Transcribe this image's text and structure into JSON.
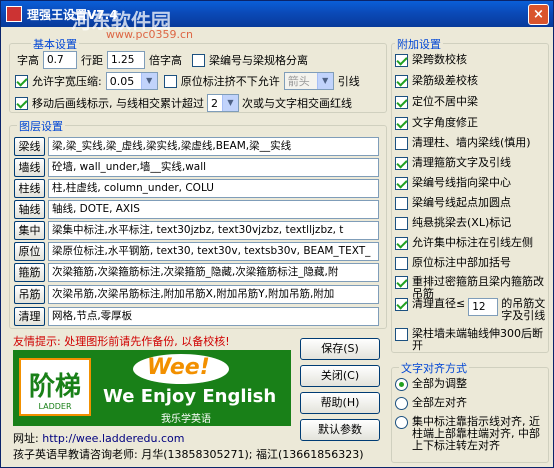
{
  "window": {
    "title": "理强王设置V7.4",
    "watermark": "河东软件园",
    "watermark_url": "www.pc0359.cn",
    "close_label": "×"
  },
  "basic": {
    "title": "基本设置",
    "row1_prefix": "字高",
    "text_height_value": "0.7",
    "line_spacing_label": "行距",
    "line_spacing_value": "1.25",
    "char_height_label": "倍字高",
    "beam_sep_label": "梁编号与梁规格分离",
    "allow_width_label": "允许字宽压缩:",
    "width_value": "0.05",
    "origin_not_move_label": "原位标注挤不下允许",
    "arrow_value": "箭头",
    "leader_label": "引线",
    "move_leader_label": "移动后画线标示, 与线相交累计超过",
    "cross_count": "2",
    "cross_suffix": "次或与文字相交画红线"
  },
  "layers": {
    "title": "图层设置",
    "rows": [
      {
        "btn": "梁线",
        "value": "梁,梁_实线,梁_虚线,梁实线,梁虚线,BEAM,梁__实线"
      },
      {
        "btn": "墙线",
        "value": "砼墙, wall_under,墙__实线,wall"
      },
      {
        "btn": "柱线",
        "value": "柱,柱虚线, column_under, COLU"
      },
      {
        "btn": "轴线",
        "value": "轴线, DOTE, AXIS"
      },
      {
        "btn": "集中",
        "value": "梁集中标注,水平标注, text30jzbz, text30vjzbz, textlljzbz, t"
      },
      {
        "btn": "原位",
        "value": "梁原位标注,水平钢筋, text30, text30v, textsb30v, BEAM_TEXT_"
      },
      {
        "btn": "箍筋",
        "value": "次梁箍筋,次梁箍筋标注,次梁箍筋_隐藏,次梁箍筋标注_隐藏,附"
      },
      {
        "btn": "吊筋",
        "value": "次梁吊筋,次梁吊筋标注,附加吊筋X,附加吊筋Y,附加吊筋,附加"
      },
      {
        "btn": "清理",
        "value": "网格,节点,零厚板"
      }
    ]
  },
  "tip": "友情提示: 处理图形前请先作备份, 以备校核!",
  "buttons": {
    "save": "保存(S)",
    "close": "关闭(C)",
    "help": "帮助(H)",
    "defaults": "默认参数"
  },
  "banner": {
    "logo_cn": "阶梯",
    "logo_en": "LADDER",
    "wee": "Wee!",
    "enjoy": "We Enjoy English",
    "slogan": "我乐学英语"
  },
  "footer": {
    "url_label": "网址:",
    "url": "http://wee.ladderedu.com",
    "contact": "孩子英语早教请咨询老师: 月华(13858305271); 福江(13661856323)"
  },
  "extra": {
    "title": "附加设置",
    "items": [
      {
        "label": "梁跨数校核",
        "checked": true
      },
      {
        "label": "梁筋级差校核",
        "checked": true
      },
      {
        "label": "定位不居中梁",
        "checked": true
      },
      {
        "label": "文字角度修正",
        "checked": true
      },
      {
        "label": "清理柱、墙内梁线(慎用)",
        "checked": false
      },
      {
        "label": "清理箍筋文字及引线",
        "checked": true
      },
      {
        "label": "梁编号线指向梁中心",
        "checked": true
      },
      {
        "label": "梁编号线起点加圆点",
        "checked": false
      },
      {
        "label": "纯悬挑梁去(XL)标记",
        "checked": false
      },
      {
        "label": "允许集中标注在引线左侧",
        "checked": true
      },
      {
        "label": "原位标注中部加括号",
        "checked": false
      },
      {
        "label": "重排过密箍筋且梁内箍筋改吊筋",
        "checked": true
      },
      {
        "label": "清理直径≤",
        "checked": true,
        "value": "12",
        "suffix": "的吊筋文字及引线"
      },
      {
        "label": "梁柱墙未端轴线伸300后断开",
        "checked": false
      }
    ]
  },
  "align": {
    "title": "文字对齐方式",
    "options": [
      {
        "label": "全部为调整",
        "checked": true
      },
      {
        "label": "全部左对齐",
        "checked": false
      },
      {
        "label": "集中标注靠指示线对齐, 近柱端上部靠柱端对齐, 中部上下标注转左对齐",
        "checked": false
      }
    ]
  }
}
